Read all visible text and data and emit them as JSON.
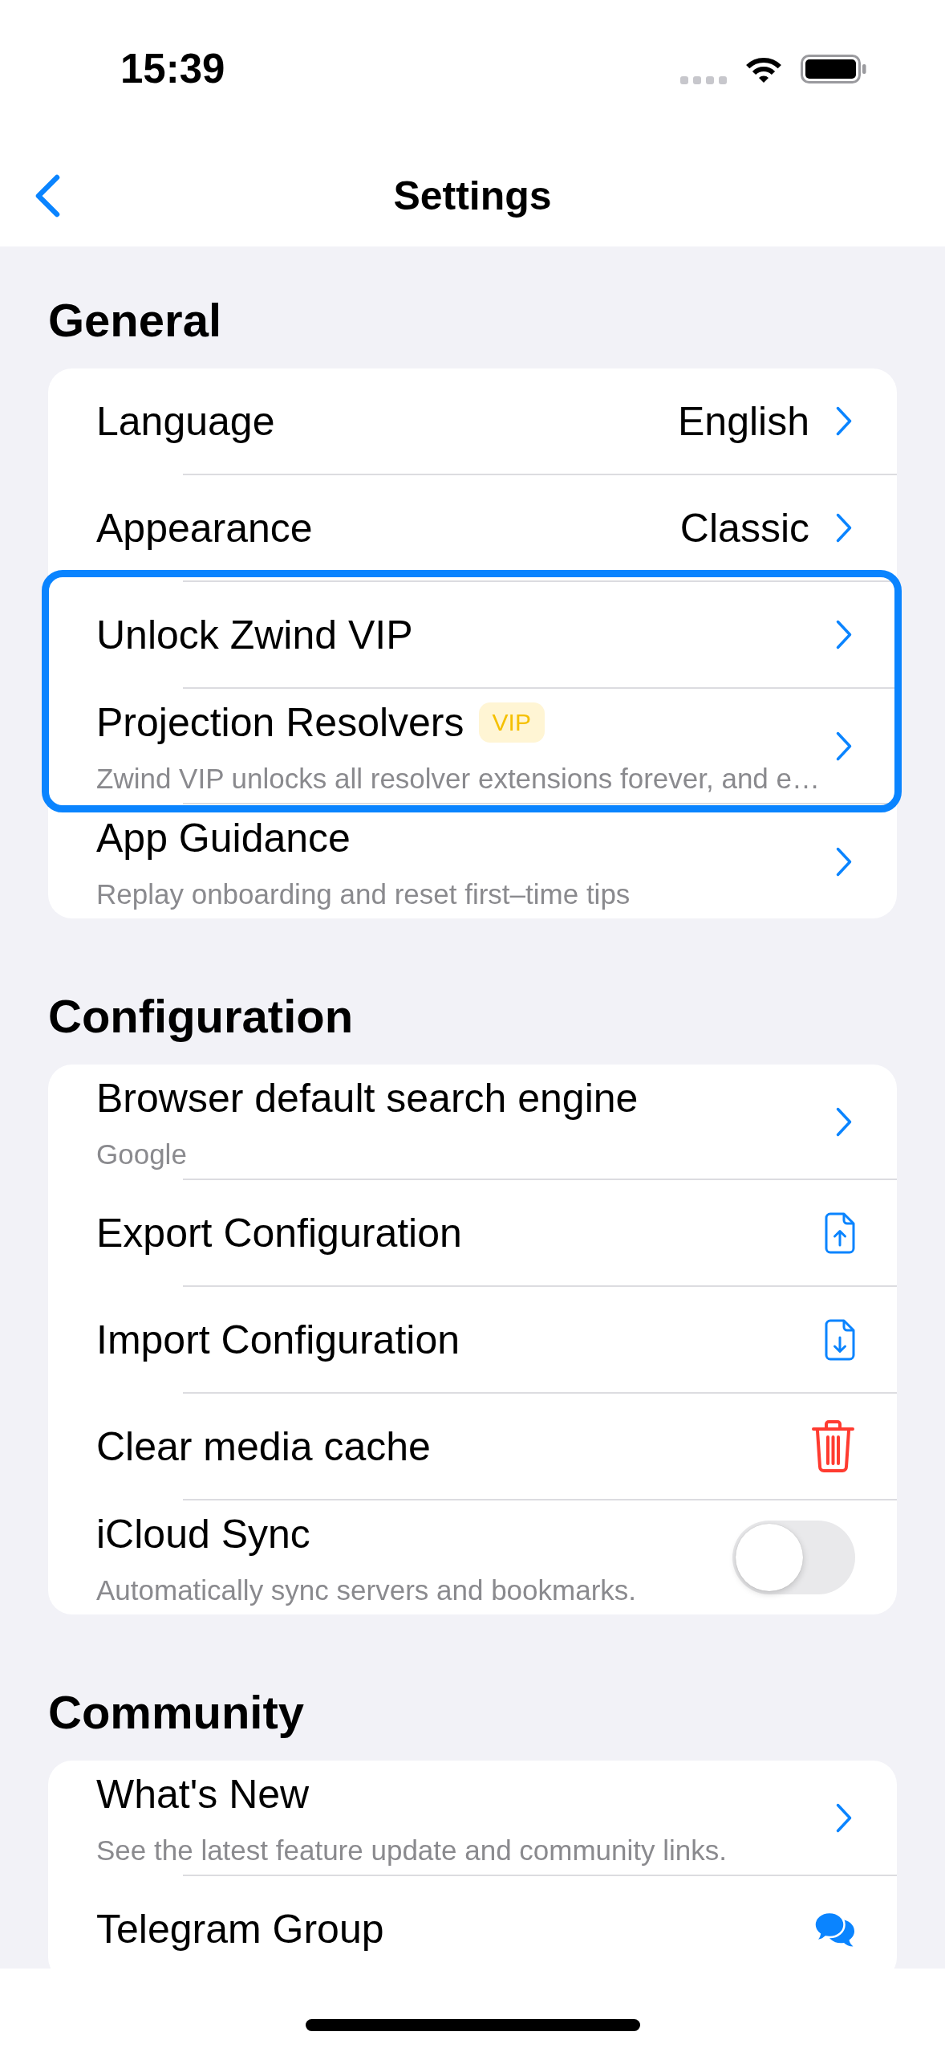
{
  "status_bar": {
    "time": "15:39"
  },
  "nav": {
    "title": "Settings"
  },
  "sections": [
    {
      "title": "General",
      "items": [
        {
          "kind": "chevron",
          "label": "Language",
          "value": "English",
          "highlighted": false
        },
        {
          "kind": "chevron",
          "label": "Appearance",
          "value": "Classic",
          "highlighted": false
        },
        {
          "kind": "chevron",
          "label": "Unlock Zwind VIP",
          "highlighted": true
        },
        {
          "kind": "chevron",
          "label": "Projection Resolvers",
          "badge": "VIP",
          "subtitle": "Zwind VIP unlocks all resolver extensions forever, and e…",
          "highlighted": true
        },
        {
          "kind": "chevron",
          "label": "App Guidance",
          "subtitle": "Replay onboarding and reset first–time tips",
          "highlighted": false
        }
      ]
    },
    {
      "title": "Configuration",
      "items": [
        {
          "kind": "chevron",
          "label": "Browser default search engine",
          "subtitle": "Google"
        },
        {
          "kind": "export",
          "label": "Export Configuration"
        },
        {
          "kind": "import",
          "label": "Import Configuration"
        },
        {
          "kind": "delete",
          "label": "Clear media cache"
        },
        {
          "kind": "toggle",
          "label": "iCloud Sync",
          "subtitle": "Automatically sync servers and bookmarks.",
          "on": false
        }
      ]
    },
    {
      "title": "Community",
      "items": [
        {
          "kind": "chevron",
          "label": "What's New",
          "subtitle": "See the latest feature update and community links."
        },
        {
          "kind": "chat",
          "label": "Telegram Group"
        }
      ]
    }
  ]
}
